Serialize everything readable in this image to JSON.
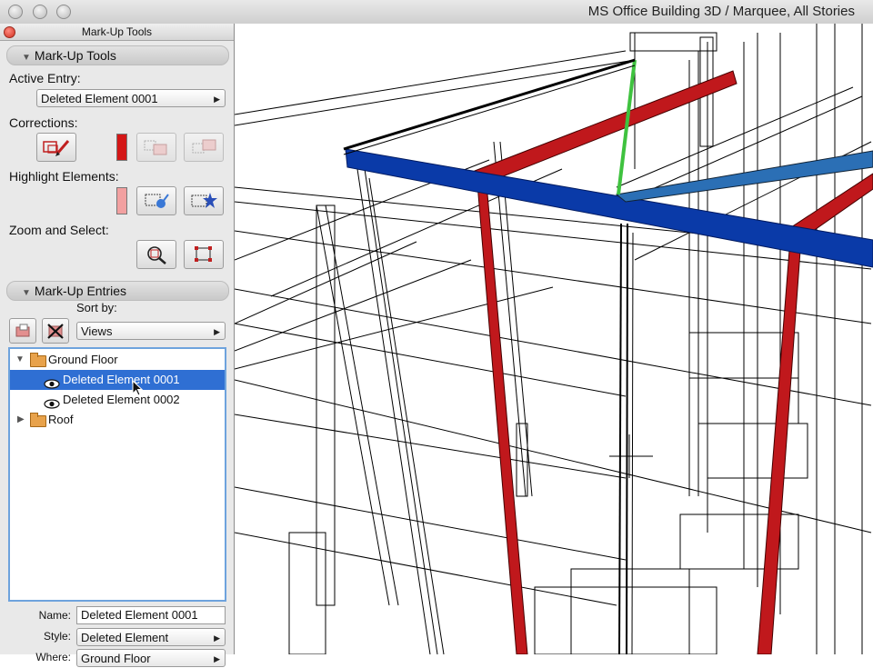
{
  "window": {
    "title": "MS Office Building 3D / Marquee, All Stories"
  },
  "palette": {
    "title": "Mark-Up Tools",
    "section1": "Mark-Up Tools",
    "active_entry_label": "Active Entry:",
    "active_entry_value": "Deleted Element 0001",
    "corrections_label": "Corrections:",
    "highlight_label": "Highlight Elements:",
    "zoom_label": "Zoom and Select:",
    "section2": "Mark-Up Entries",
    "sort_by_label": "Sort by:",
    "sort_by_value": "Views",
    "tree": [
      {
        "label": "Ground Floor",
        "type": "folder",
        "expanded": true
      },
      {
        "label": "Deleted Element 0001",
        "type": "entry",
        "selected": true
      },
      {
        "label": "Deleted Element 0002",
        "type": "entry",
        "selected": false
      },
      {
        "label": "Roof",
        "type": "folder",
        "expanded": false
      }
    ],
    "name_label": "Name:",
    "name_value": "Deleted Element 0001",
    "style_label": "Style:",
    "style_value": "Deleted Element",
    "where_label": "Where:",
    "where_value": "Ground Floor"
  },
  "colors": {
    "correction_color": "#d41717",
    "highlight_color": "#f2a0a0",
    "selection": "#2f6fd3",
    "blue_beam": "#0a3aa8",
    "red_column": "#c0181c",
    "green_line": "#3fc23f"
  }
}
